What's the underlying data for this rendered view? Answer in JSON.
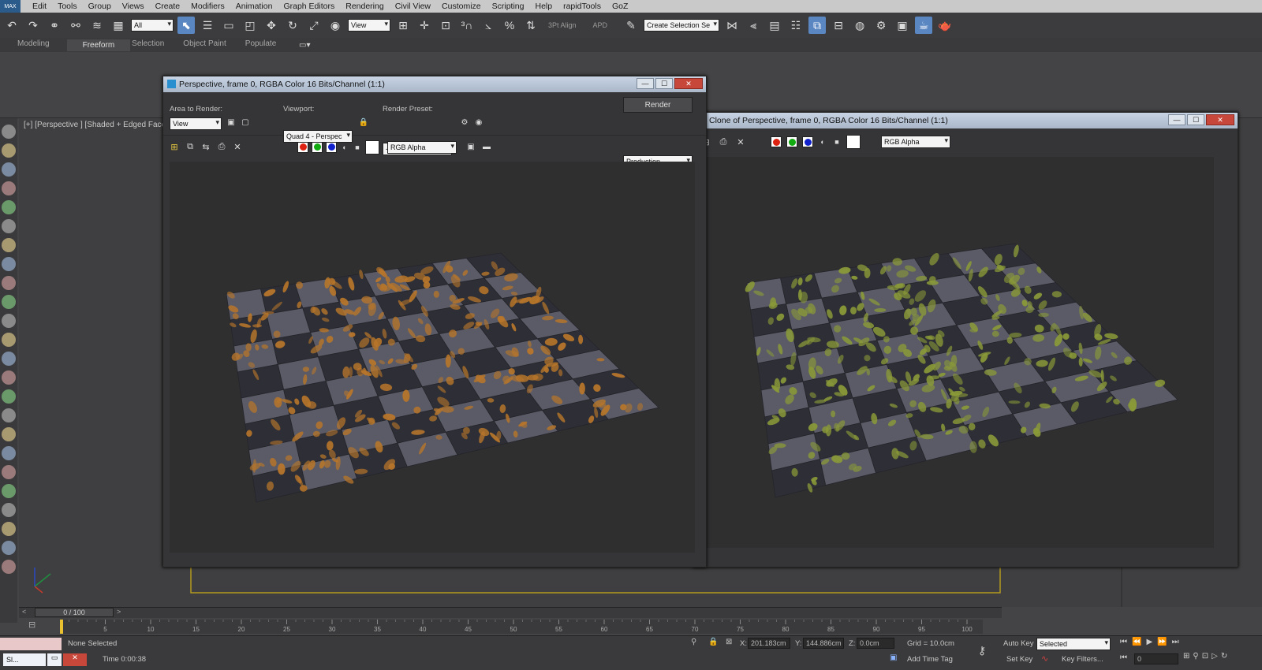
{
  "menu": [
    "Edit",
    "Tools",
    "Group",
    "Views",
    "Create",
    "Modifiers",
    "Animation",
    "Graph Editors",
    "Rendering",
    "Civil View",
    "Customize",
    "Scripting",
    "Help",
    "rapidTools",
    "GoZ"
  ],
  "toolbar": {
    "selection_filter": "All",
    "ref_coord": "View",
    "snap_label": "3Pt Align",
    "apd_label": "APD",
    "named_selection": "Create Selection Se"
  },
  "ribbon_tabs": [
    "Modeling",
    "Freeform",
    "Selection",
    "Object Paint",
    "Populate"
  ],
  "ribbon_selected": "Freeform",
  "viewport_label": "[+] [Perspective ] [Shaded + Edged Faces",
  "render_window": {
    "title": "Perspective, frame 0, RGBA Color 16 Bits/Channel (1:1)",
    "area_label": "Area to Render:",
    "area_value": "View",
    "viewport_label": "Viewport:",
    "viewport_value": "Quad 4 - Perspec",
    "preset_label": "Render Preset:",
    "preset_value": "-------------------",
    "render_button": "Render",
    "production_value": "Production",
    "channel_value": "RGB Alpha"
  },
  "clone_window": {
    "title": "Clone of Perspective, frame 0, RGBA Color 16 Bits/Channel (1:1)",
    "channel_value": "RGB Alpha"
  },
  "timeline": {
    "frame_counter": "0 / 100",
    "ticks": [
      "5",
      "10",
      "15",
      "20",
      "25",
      "30",
      "35",
      "40",
      "45",
      "50",
      "55",
      "60",
      "65",
      "70",
      "75",
      "80",
      "85",
      "90",
      "95",
      "100"
    ]
  },
  "status": {
    "selection": "None Selected",
    "time": "Time  0:00:38",
    "x_label": "X:",
    "x_value": "201.183cm",
    "y_label": "Y:",
    "y_value": "144.886cm",
    "z_label": "Z:",
    "z_value": "0.0cm",
    "grid": "Grid = 10.0cm",
    "add_time_tag": "Add Time Tag",
    "auto_key": "Auto Key",
    "set_key": "Set Key",
    "key_mode": "Selected",
    "key_filters": "Key Filters...",
    "frame_field": "0",
    "taskbar_item": "Sl..."
  },
  "colors": {
    "accent": "#5a86c2",
    "render_bg": "#2f2f30",
    "leaf_orange": "#b8762a",
    "leaf_green": "#8a9a38",
    "tile_light": "#5a5b66",
    "tile_dark": "#2e2f36"
  }
}
